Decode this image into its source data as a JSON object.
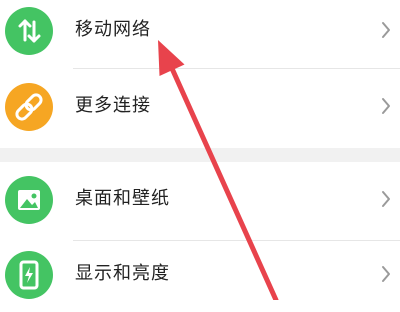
{
  "settings": {
    "items": [
      {
        "label": "移动网络",
        "icon": "up-down-arrows-icon",
        "color": "#44c463"
      },
      {
        "label": "更多连接",
        "icon": "link-icon",
        "color": "#f6a623"
      },
      {
        "label": "桌面和壁纸",
        "icon": "image-icon",
        "color": "#44c463"
      },
      {
        "label": "显示和亮度",
        "icon": "phone-brightness-icon",
        "color": "#44c463"
      }
    ]
  },
  "annotation": {
    "arrow_color": "#e8434c"
  }
}
